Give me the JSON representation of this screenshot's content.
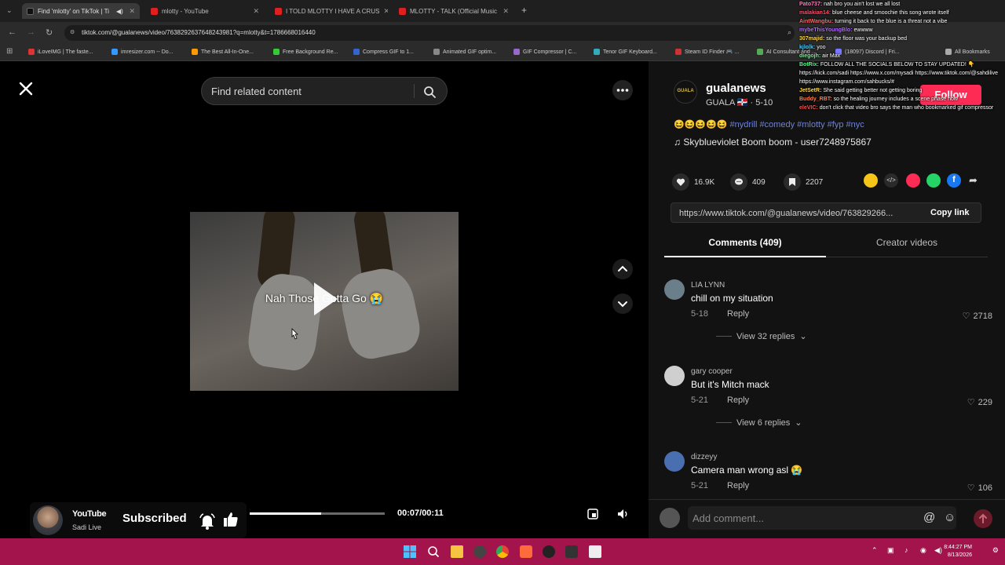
{
  "browser": {
    "tabs": [
      {
        "label": "Find 'mlotty' on TikTok | Ti",
        "active": true,
        "icon": "tiktok-icon"
      },
      {
        "label": "mlotty - YouTube",
        "active": false,
        "icon": "youtube-icon"
      },
      {
        "label": "I TOLD MLOTTY I HAVE A CRUS",
        "active": false,
        "icon": "youtube-icon"
      },
      {
        "label": "MLOTTY - TALK (Official Music",
        "active": false,
        "icon": "youtube-icon"
      }
    ],
    "url": "tiktok.com/@gualanews/video/7638292637648243981?q=mlotty&t=1786668016440",
    "bookmarks": [
      "iLoveIMG | The faste...",
      "imresizer.com -- Do...",
      "The Best All-In-One...",
      "Free Background Re...",
      "Compress GIF to 1...",
      "Animated GIF optim...",
      "GIF Compressor | C...",
      "Tenor GIF Keyboard...",
      "Steam ID Finder 🎮 ...",
      "AI Consultant and ...",
      "(18097) Discord | Fri...",
      "All Bookmarks"
    ]
  },
  "search": {
    "placeholder": "Find related content"
  },
  "video": {
    "caption": "Nah Those Gotta Go 😭",
    "time": "00:07/00:11",
    "progress": 0.53
  },
  "creator": {
    "username": "gualanews",
    "subline": "GUALA 🇩🇴 · 5-10",
    "avatar_text": "GUALA",
    "follow_label": "Follow",
    "description": "😆😆😆😆😆 #nydrill #comedy #mlotty #fyp #nyc",
    "music": "♫  Skyblueviolet Boom boom - user7248975867"
  },
  "actions": {
    "likes": "16.9K",
    "comments": "409",
    "saves": "2207"
  },
  "link": {
    "url": "https://www.tiktok.com/@gualanews/video/763829266...",
    "copy_label": "Copy link"
  },
  "tabs": {
    "comments": "Comments (409)",
    "creator_videos": "Creator videos"
  },
  "comments": [
    {
      "user": "LIA LYNN",
      "text": "chill on my situation",
      "date": "5-18",
      "reply": "Reply",
      "likes": "2718",
      "replies": "View 32 replies",
      "avatar_color": "#6b7f8a"
    },
    {
      "user": "gary cooper",
      "text": "But it's Mitch mack",
      "date": "5-21",
      "reply": "Reply",
      "likes": "229",
      "replies": "View 6 replies",
      "avatar_color": "#cfcfcf"
    },
    {
      "user": "dizzeyy",
      "text": "Camera man wrong asl 😭",
      "date": "5-21",
      "reply": "Reply",
      "likes": "106",
      "replies": "",
      "avatar_color": "#4a6fb0"
    }
  ],
  "comment_bar": {
    "placeholder": "Add comment..."
  },
  "chat": [
    {
      "user": "Pato737:",
      "msg": "nah bro you ain't lost we all lost",
      "color": "#ff7fbf"
    },
    {
      "user": "malakian14:",
      "msg": "blue cheese and smoochie this song wrote itself",
      "color": "#ff4d6d"
    },
    {
      "user": "AintWangbu:",
      "msg": "turning it back to the blue is a threat not a vibe",
      "color": "#ff6b6b"
    },
    {
      "user": "mybeThisYoungBlo:",
      "msg": "ewwww",
      "color": "#b56bff"
    },
    {
      "user": "307majid:",
      "msg": "so the floor was your backup bed",
      "color": "#ffd84d"
    },
    {
      "user": "kjlolk:",
      "msg": "yoo",
      "color": "#4dd2ff"
    },
    {
      "user": "diegojh:",
      "msg": "air Max",
      "color": "#6bff8f"
    },
    {
      "user": "BotRix:",
      "msg": "FOLLOW ALL THE SOCIALS BELOW TO STAY UPDATED! 👇 https://kick.com/sadi https://www.x.com/mysadi https://www.tiktok.com/@sahdilive https://www.instagram.com/sahbucks/#",
      "color": "#4dff88"
    },
    {
      "user": "JetSetR:",
      "msg": "She said getting better not getting boring",
      "color": "#ffd84d"
    },
    {
      "user": "Buddy_RBT:",
      "msg": "so the healing journey includes a scene phase now",
      "color": "#ff7f4d"
    },
    {
      "user": "eleVIC:",
      "msg": "don't click that video bro says the man who bookmarked gif compressor",
      "color": "#ff4d4d"
    }
  ],
  "overlay": {
    "yt_logo": "YouTube",
    "channel": "Sadi Live",
    "subscribed": "Subscribed"
  },
  "taskbar": {
    "time": "8:44:27 PM",
    "date": "8/13/2026",
    "color": "#a3134c"
  },
  "colors": {
    "accent": "#fe2c55",
    "hashtag": "#6f83d6"
  }
}
